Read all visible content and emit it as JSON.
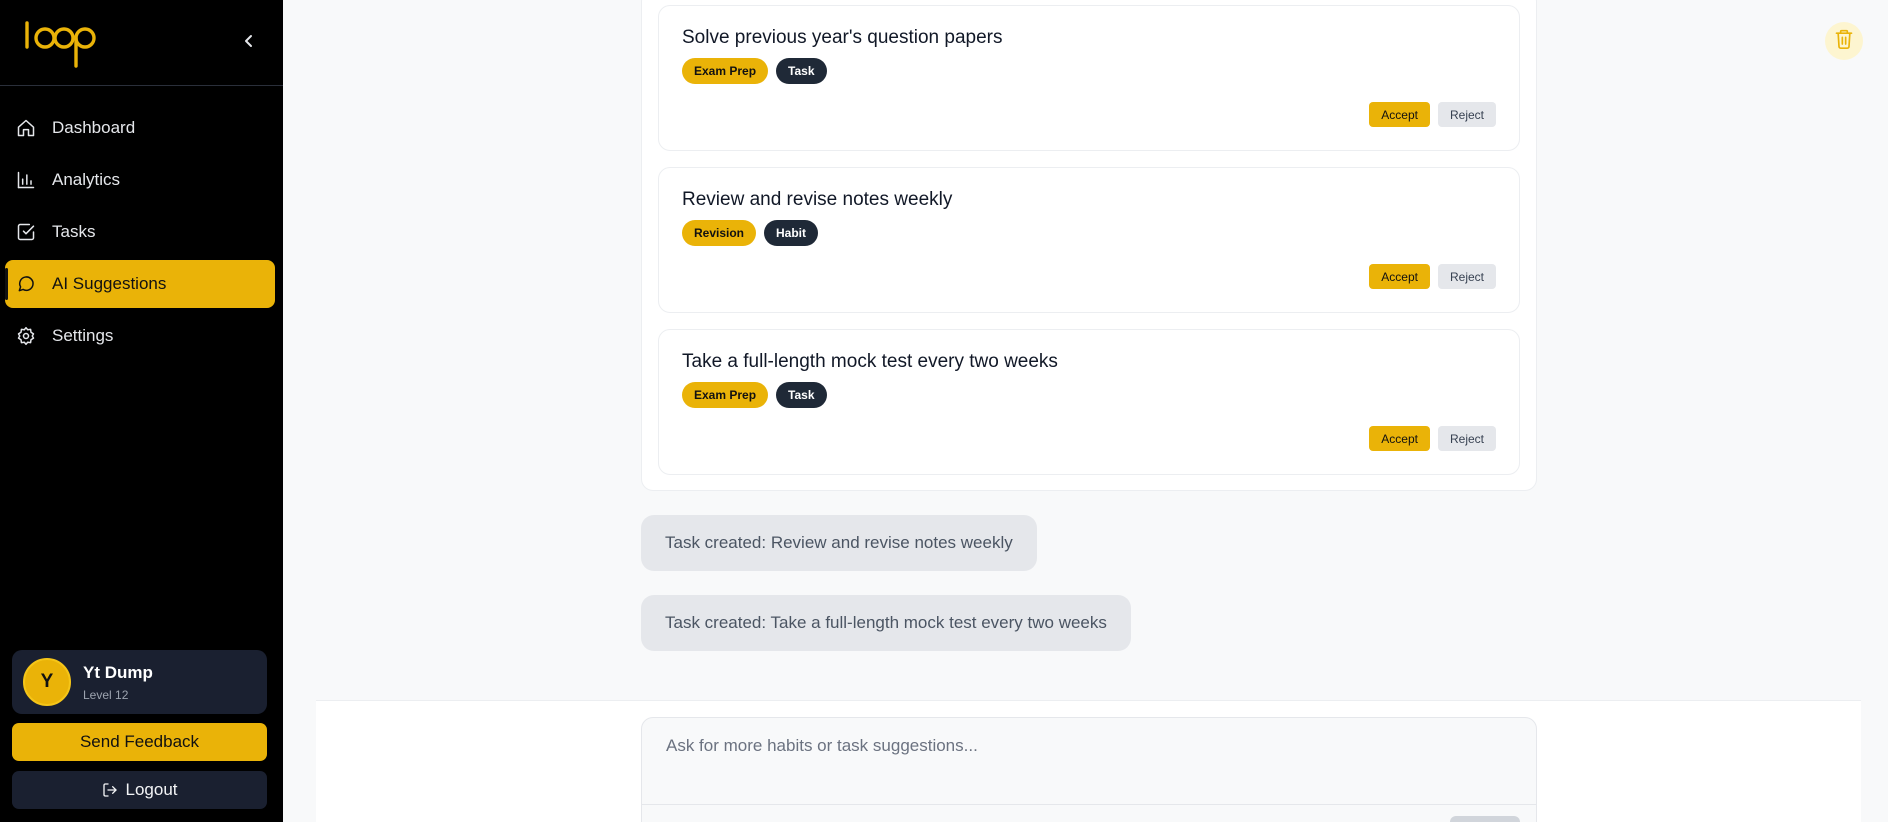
{
  "sidebar": {
    "logo_text": "loop",
    "collapse_icon": "chevron-left-icon",
    "items": [
      {
        "label": "Dashboard",
        "icon": "home-icon"
      },
      {
        "label": "Analytics",
        "icon": "bar-chart-icon"
      },
      {
        "label": "Tasks",
        "icon": "check-square-icon"
      },
      {
        "label": "AI Suggestions",
        "icon": "message-circle-icon",
        "active": true
      },
      {
        "label": "Settings",
        "icon": "gear-icon"
      }
    ],
    "user": {
      "initial": "Y",
      "name": "Yt Dump",
      "level": "Level 12"
    },
    "feedback_label": "Send Feedback",
    "logout_label": "Logout"
  },
  "main": {
    "suggestions": [
      {
        "title": "Solve previous year's question papers",
        "category": "Exam Prep",
        "type": "Task",
        "accept_label": "Accept",
        "reject_label": "Reject"
      },
      {
        "title": "Review and revise notes weekly",
        "category": "Revision",
        "type": "Habit",
        "accept_label": "Accept",
        "reject_label": "Reject"
      },
      {
        "title": "Take a full-length mock test every two weeks",
        "category": "Exam Prep",
        "type": "Task",
        "accept_label": "Accept",
        "reject_label": "Reject"
      }
    ],
    "messages": [
      "Task created: Review and revise notes weekly",
      "Task created: Take a full-length mock test every two weeks"
    ],
    "chat_placeholder": "Ask for more habits or task suggestions..."
  },
  "colors": {
    "accent": "#eab308",
    "sidebar_bg": "#000000",
    "dark_tag": "#1f2937"
  }
}
